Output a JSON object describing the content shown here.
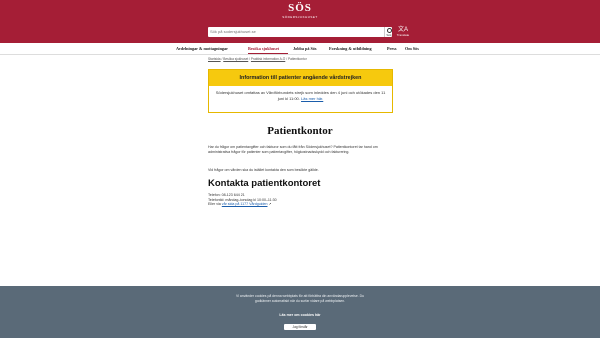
{
  "header": {
    "logo_mark": "SÖS",
    "logo_sub": "SÖDERSJUKHUSET",
    "search_placeholder": "Sök på sodersjukhuset.se",
    "search_button_label": "Sök",
    "translate_label": "Translate",
    "translate_glyph": "文A"
  },
  "nav": {
    "items": [
      {
        "label": "Avdelningar & mottagningar"
      },
      {
        "label": "Besöka sjukhuset"
      },
      {
        "label": "Jobba på Sös"
      },
      {
        "label": "Forskning & utbildning"
      },
      {
        "label": "Press"
      },
      {
        "label": "Om Sös"
      }
    ]
  },
  "breadcrumb": {
    "items": [
      "Startsida",
      "Besöka sjukhuset",
      "Praktisk information A-Ö",
      "Patientkontor"
    ],
    "separator": "/"
  },
  "notice": {
    "title": "Information till patienter angående vårdstrejken",
    "body": "Södersjukhuset omfattas av Vårdförbundets strejk som inleddes den 4 juni och utökades den 11 juni kl 11:00.",
    "link": "Läs mer här."
  },
  "main": {
    "title": "Patientkontor",
    "para1": "Har du frågor om patientavgifter och fakturor som du fått från Södersjukhuset? Patientkontoret tar hand om administrativa frågor för patienter som patientavgifter, högkostnadsskydd och fakturering.",
    "para2": "Vid frågor om vården ska du istället kontakta den som besökte gällde.",
    "contact_heading": "Kontakta patientkontoret",
    "contact_phone": "Telefon: 08-123 644 21",
    "contact_hours": "Telefontid: måndag–torsdag kl 10:00–11:30",
    "contact_prefix": "Eller via",
    "contact_link": "vår sida på 1177 Vårdguiden"
  },
  "cookie": {
    "text": "Vi använder cookies på denna webbplats för att förbättra din användarupplevelse. Du godkänner automatiskt när du surfar vidare på webbplatsen.",
    "link": "Läs mer om cookies här",
    "button": "Jag förstår"
  },
  "colors": {
    "brand": "#a51e36",
    "notice_bg": "#f6c90e",
    "cookie_bg": "#5a6a78",
    "link": "#1a5dab"
  }
}
